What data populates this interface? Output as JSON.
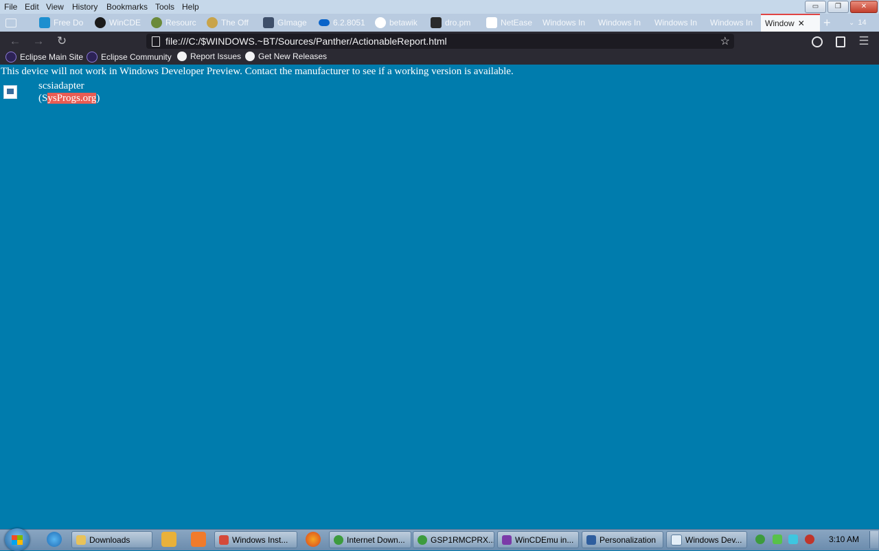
{
  "menu": {
    "items": [
      "File",
      "Edit",
      "View",
      "History",
      "Bookmarks",
      "Tools",
      "Help"
    ]
  },
  "window_controls": {
    "minimize": "▭",
    "restore": "❐",
    "close": "✕"
  },
  "tabs": [
    {
      "label": "Free Do",
      "icon": "free-download-icon"
    },
    {
      "label": "WinCDE",
      "icon": "gear-icon"
    },
    {
      "label": "Resourc",
      "icon": "resource-icon"
    },
    {
      "label": "The Off",
      "icon": "office-icon"
    },
    {
      "label": "GImage",
      "icon": "gimage-icon"
    },
    {
      "label": "6.2.8051",
      "icon": "onedrive-cloud-icon"
    },
    {
      "label": "betawik",
      "icon": "google-icon"
    },
    {
      "label": "dro.pm",
      "icon": "dropm-icon"
    },
    {
      "label": "NetEase",
      "icon": "wikipedia-icon"
    },
    {
      "label": "Windows In",
      "icon": ""
    },
    {
      "label": "Windows In",
      "icon": ""
    },
    {
      "label": "Windows In",
      "icon": ""
    },
    {
      "label": "Windows In",
      "icon": ""
    }
  ],
  "active_tab": {
    "label": "Window",
    "close": "✕"
  },
  "new_tab": "+",
  "tab_list_count": "14",
  "toolbar": {
    "back": "←",
    "forward": "→",
    "reload": "↻",
    "url": "file:///C:/$WINDOWS.~BT/Sources/Panther/ActionableReport.html",
    "bookmark_star": "☆"
  },
  "bookmarks": [
    {
      "label": "Eclipse Main Site",
      "icon": "eclipse-icon"
    },
    {
      "label": "Eclipse Community",
      "icon": "eclipse-icon"
    },
    {
      "label": "Report Issues",
      "icon": "github-icon"
    },
    {
      "label": "Get New Releases",
      "icon": "github-icon"
    }
  ],
  "page": {
    "warning": "This device will not work in Windows Developer Preview. Contact the manufacturer to see if a working version is available.",
    "device_name": "scsiadapter",
    "manufacturer_prefix": "(S",
    "manufacturer_highlight": "ysProgs.org",
    "manufacturer_suffix": ")"
  },
  "taskbar": {
    "buttons": [
      {
        "label": "Downloads",
        "icon": "folder-icon"
      },
      {
        "label": "Windows Inst...",
        "icon": "gmail-icon"
      },
      {
        "label": "Internet Down...",
        "icon": "idm-icon"
      },
      {
        "label": "GSP1RMCPRX...",
        "icon": "idm-icon"
      },
      {
        "label": "WinCDEmu in...",
        "icon": "visual-studio-icon"
      },
      {
        "label": "Personalization",
        "icon": "personalization-icon"
      },
      {
        "label": "Windows Dev...",
        "icon": "document-icon"
      }
    ],
    "clock": "3:10 AM"
  },
  "colors": {
    "page_background": "#007cad",
    "highlight": "#e95c53",
    "toolbar": "#2b2a33",
    "active_tab_accent": "#e04343"
  }
}
